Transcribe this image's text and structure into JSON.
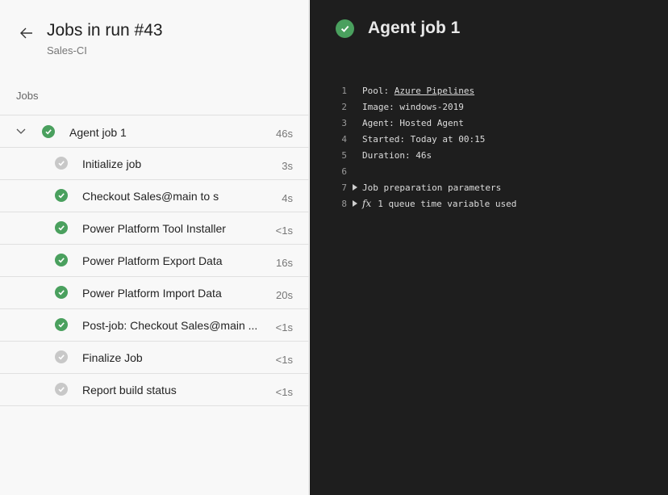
{
  "header": {
    "title": "Jobs in run #43",
    "subtitle": "Sales-CI"
  },
  "jobs_section_label": "Jobs",
  "jobs": [
    {
      "label": "Agent job 1",
      "duration": "46s",
      "status": "succeeded",
      "level": 0,
      "expanded": true
    },
    {
      "label": "Initialize job",
      "duration": "3s",
      "status": "skipped",
      "level": 1
    },
    {
      "label": "Checkout Sales@main to s",
      "duration": "4s",
      "status": "succeeded",
      "level": 1
    },
    {
      "label": "Power Platform Tool Installer",
      "duration": "<1s",
      "status": "succeeded",
      "level": 1
    },
    {
      "label": "Power Platform Export Data",
      "duration": "16s",
      "status": "succeeded",
      "level": 1
    },
    {
      "label": "Power Platform Import Data",
      "duration": "20s",
      "status": "succeeded",
      "level": 1
    },
    {
      "label": "Post-job: Checkout Sales@main ...",
      "duration": "<1s",
      "status": "succeeded",
      "level": 1
    },
    {
      "label": "Finalize Job",
      "duration": "<1s",
      "status": "skipped",
      "level": 1
    },
    {
      "label": "Report build status",
      "duration": "<1s",
      "status": "skipped",
      "level": 1
    }
  ],
  "detail": {
    "title": "Agent job 1",
    "status": "succeeded",
    "log": [
      {
        "n": "1",
        "prefix": "Pool: ",
        "link": "Azure Pipelines"
      },
      {
        "n": "2",
        "text": "Image: windows-2019"
      },
      {
        "n": "3",
        "text": "Agent: Hosted Agent"
      },
      {
        "n": "4",
        "text": "Started: Today at 00:15"
      },
      {
        "n": "5",
        "text": "Duration: 46s"
      },
      {
        "n": "6",
        "text": ""
      },
      {
        "n": "7",
        "text": "Job preparation parameters",
        "collapsible": true
      },
      {
        "n": "8",
        "text": "1 queue time variable used",
        "collapsible": true,
        "fx": "fx"
      }
    ]
  },
  "colors": {
    "success": "#4aa05e",
    "skipped": "#c8c8c8",
    "log_background": "#1e1e1e",
    "panel_background": "#f8f8f8"
  }
}
